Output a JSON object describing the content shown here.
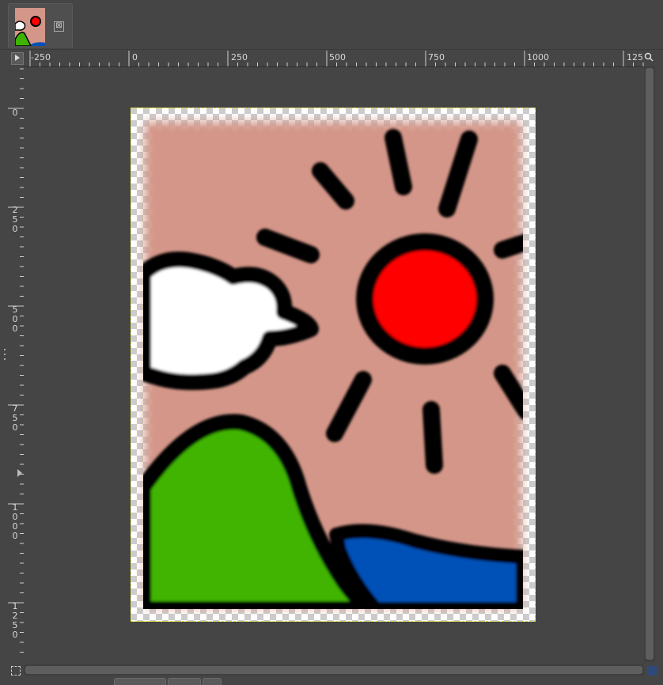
{
  "tab": {
    "thumbnail_icon": "image-thumbnail",
    "close_label": "⊠"
  },
  "rulers": {
    "horizontal_labels": [
      "-250",
      "0",
      "250",
      "500",
      "750",
      "1000",
      "125"
    ],
    "vertical_labels": [
      "0",
      "250",
      "500",
      "750",
      "1000",
      "1250"
    ]
  },
  "icons": {
    "ruler_menu": "triangle-menu-icon",
    "zoom": "zoom-icon",
    "quick_mask": "quick-mask-icon",
    "navigate": "navigate-icon"
  },
  "image": {
    "colors": {
      "background": "#d49688",
      "sun": "#ff0000",
      "hill": "#3fb400",
      "water": "#0051b7",
      "cloud": "#ffffff",
      "outline": "#000000",
      "selection": "#e6e634"
    }
  }
}
